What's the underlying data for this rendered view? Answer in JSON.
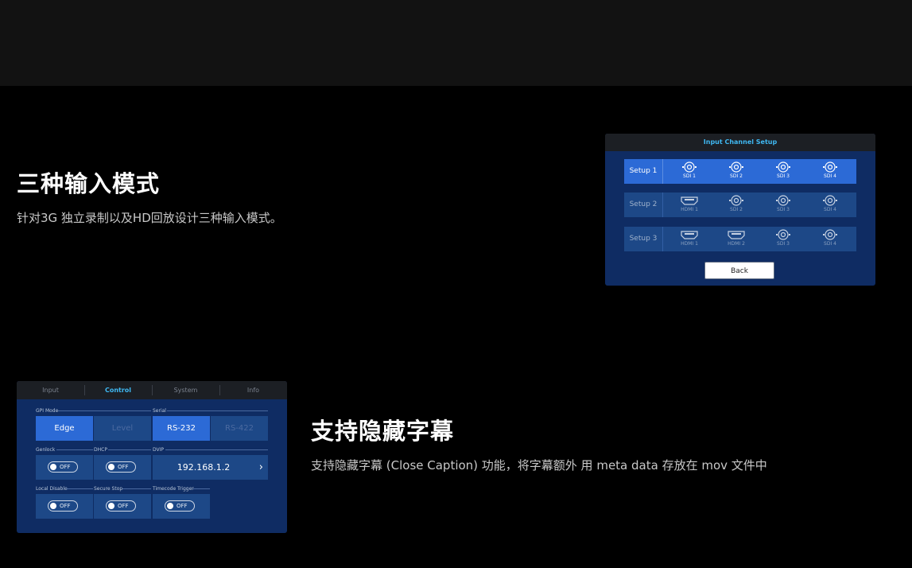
{
  "feature1": {
    "title": "三种输入模式",
    "desc": "针对3G 独立录制以及HD回放设计三种输入模式。"
  },
  "feature2": {
    "title": "支持隐藏字幕",
    "desc": "支持隐藏字幕 (Close Caption) 功能，将字幕额外 用 meta data 存放在 mov 文件中"
  },
  "panel1": {
    "title": "Input Channel Setup",
    "rows": [
      {
        "label": "Setup 1",
        "channels": [
          "SDI 1",
          "SDI 2",
          "SDI 3",
          "SDI 4"
        ]
      },
      {
        "label": "Setup 2",
        "channels": [
          "HDMI 1",
          "SDI 2",
          "SDI 3",
          "SDI 4"
        ]
      },
      {
        "label": "Setup 3",
        "channels": [
          "HDMI 1",
          "HDMI 2",
          "SDI 3",
          "SDI 4"
        ]
      }
    ],
    "back_label": "Back",
    "colors": {
      "accent": "#3fb8f2",
      "active_row": "#2c6ad6",
      "panel_bg": "#0f2c63"
    }
  },
  "panel2": {
    "tabs": [
      "Input",
      "Control",
      "System",
      "Info"
    ],
    "active_tab": "Control",
    "gpi_mode_label": "GPI Mode",
    "gpi_options": [
      "Edge",
      "Level"
    ],
    "gpi_selected": "Edge",
    "serial_label": "Serial",
    "serial_options": [
      "RS-232",
      "RS-422"
    ],
    "serial_selected": "RS-232",
    "genlock_label": "Genlock",
    "genlock_value": "OFF",
    "dhcp_label": "DHCP",
    "dhcp_value": "OFF",
    "dvip_label": "DVIP",
    "dvip_value": "192.168.1.2",
    "local_disable_label": "Local Disable",
    "local_disable_value": "OFF",
    "secure_stop_label": "Secure Stop",
    "secure_stop_value": "OFF",
    "timecode_trigger_label": "Timecode Trigger",
    "timecode_trigger_value": "OFF"
  }
}
